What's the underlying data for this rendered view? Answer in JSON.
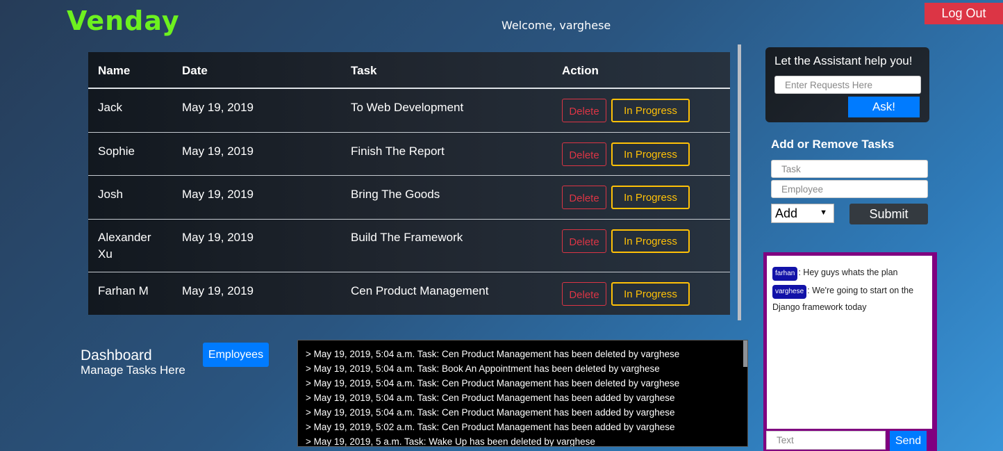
{
  "app": {
    "logo": "Venday",
    "welcome": "Welcome, varghese",
    "logout_label": "Log Out"
  },
  "table": {
    "headers": [
      "Name",
      "Date",
      "Task",
      "Action"
    ],
    "rows": [
      {
        "name": "Jack",
        "date": "May 19, 2019",
        "task": "To Web Development",
        "delete_label": "Delete",
        "status_label": "In Progress"
      },
      {
        "name": "Sophie",
        "date": "May 19, 2019",
        "task": "Finish The Report",
        "delete_label": "Delete",
        "status_label": "In Progress"
      },
      {
        "name": "Josh",
        "date": "May 19, 2019",
        "task": "Bring The Goods",
        "delete_label": "Delete",
        "status_label": "In Progress"
      },
      {
        "name": "Alexander Xu",
        "date": "May 19, 2019",
        "task": "Build The Framework",
        "delete_label": "Delete",
        "status_label": "In Progress"
      },
      {
        "name": "Farhan M",
        "date": "May 19, 2019",
        "task": "Cen Product Management",
        "delete_label": "Delete",
        "status_label": "In Progress"
      }
    ]
  },
  "dashboard": {
    "title": "Dashboard",
    "subtitle": "Manage Tasks Here",
    "employees_label": "Employees"
  },
  "log": {
    "lines": [
      "> May 19, 2019, 5:04 a.m. Task: Cen Product Management has been deleted by varghese",
      "> May 19, 2019, 5:04 a.m. Task: Book An Appointment has been deleted by varghese",
      "> May 19, 2019, 5:04 a.m. Task: Cen Product Management has been deleted by varghese",
      "> May 19, 2019, 5:04 a.m. Task: Cen Product Management has been added by varghese",
      "> May 19, 2019, 5:04 a.m. Task: Cen Product Management has been added by varghese",
      "> May 19, 2019, 5:02 a.m. Task: Cen Product Management has been added by varghese",
      "> May 19, 2019, 5 a.m. Task: Wake Up has been deleted by varghese"
    ]
  },
  "assistant": {
    "title": "Let the Assistant help you!",
    "placeholder": "Enter Requests Here",
    "ask_label": "Ask!"
  },
  "tasks_form": {
    "title": "Add or Remove Tasks",
    "task_placeholder": "Task",
    "employee_placeholder": "Employee",
    "selected_action": "Add",
    "submit_label": "Submit"
  },
  "chat": {
    "messages": [
      {
        "user": "farhan",
        "text": ": Hey guys whats the plan"
      },
      {
        "user": "varghese",
        "text": ": We're going to start on the",
        "text2": "Django framework today"
      }
    ],
    "input_placeholder": "Text",
    "send_label": "Send"
  },
  "colors": {
    "logo": "#6df11f",
    "danger": "#dc3545",
    "warning": "#ffc107",
    "primary": "#007bff",
    "chat_border": "#800080",
    "badge": "#1212a8"
  }
}
